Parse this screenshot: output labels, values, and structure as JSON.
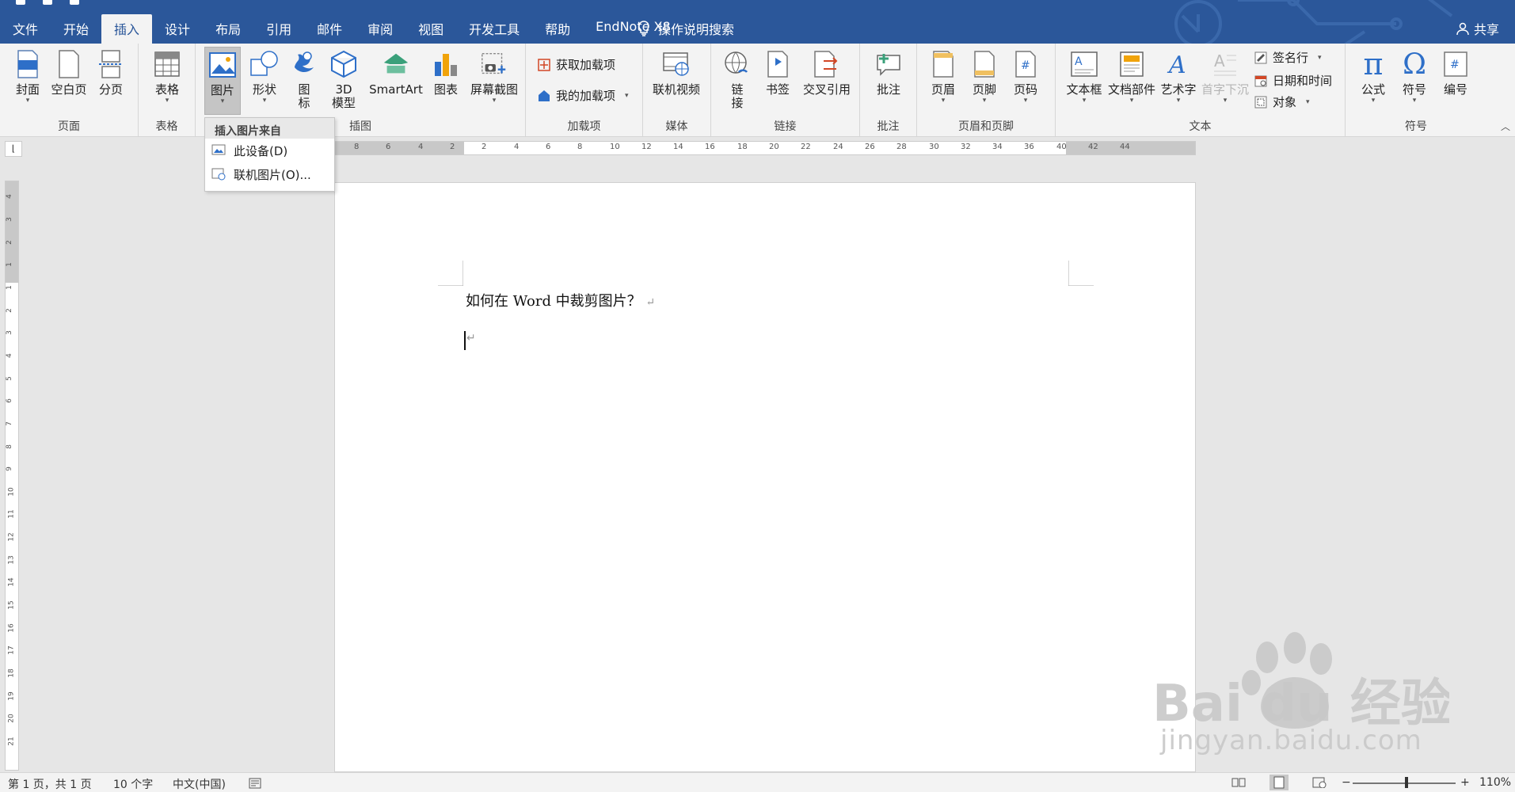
{
  "tabs": [
    "文件",
    "开始",
    "插入",
    "设计",
    "布局",
    "引用",
    "邮件",
    "审阅",
    "视图",
    "开发工具",
    "帮助",
    "EndNote X8"
  ],
  "active_tab": "插入",
  "tell_me": "操作说明搜索",
  "share": "共享",
  "ribbon": {
    "pages": {
      "label": "页面",
      "cover": "封面",
      "blank": "空白页",
      "break": "分页"
    },
    "tables": {
      "label": "表格",
      "table": "表格"
    },
    "illustrations": {
      "label": "插图",
      "pictures": "图片",
      "shapes": "形状",
      "icons_l1": "图",
      "icons_l2": "标",
      "model3d_l1": "3D",
      "model3d_l2": "模型",
      "smartart": "SmartArt",
      "chart": "图表",
      "screenshot": "屏幕截图"
    },
    "addins": {
      "label": "加载项",
      "get": "获取加载项",
      "my": "我的加载项"
    },
    "media": {
      "label": "媒体",
      "video": "联机视频"
    },
    "links": {
      "label": "链接",
      "link_l1": "链",
      "link_l2": "接",
      "bookmark": "书签",
      "crossref": "交叉引用"
    },
    "comments": {
      "label": "批注",
      "comment": "批注"
    },
    "header_footer": {
      "label": "页眉和页脚",
      "header": "页眉",
      "footer": "页脚",
      "page_number": "页码"
    },
    "text": {
      "label": "文本",
      "textbox": "文本框",
      "quickparts": "文档部件",
      "wordart": "艺术字",
      "dropcap": "首字下沉",
      "signature": "签名行",
      "datetime": "日期和时间",
      "object": "对象"
    },
    "symbols": {
      "label": "符号",
      "equation": "公式",
      "symbol": "符号",
      "numbering": "编号"
    }
  },
  "picture_menu": {
    "header": "插入图片来自",
    "items": [
      "此设备(D)",
      "联机图片(O)..."
    ]
  },
  "ruler_numbers_h": [
    "8",
    "6",
    "4",
    "2",
    "2",
    "4",
    "6",
    "8",
    "10",
    "12",
    "14",
    "16",
    "18",
    "20",
    "22",
    "24",
    "26",
    "28",
    "30",
    "32",
    "34",
    "36",
    "40",
    "42",
    "44"
  ],
  "ruler_numbers_v": [
    "4",
    "3",
    "2",
    "1",
    "1",
    "2",
    "3",
    "4",
    "5",
    "6",
    "7",
    "8",
    "9",
    "10",
    "11",
    "12",
    "13",
    "14",
    "15",
    "16",
    "17",
    "18",
    "19",
    "20",
    "21"
  ],
  "document": {
    "title_line": "如何在 Word 中裁剪图片？",
    "para_mark": "↵"
  },
  "status": {
    "page": "第 1 页，共 1 页",
    "words": "10 个字",
    "language": "中文(中国)",
    "zoom_minus": "−",
    "zoom_plus": "+",
    "zoom": "110%"
  },
  "watermark": {
    "brand": "Bai du 经验",
    "url": "jingyan.baidu.com"
  },
  "colors": {
    "title_bar": "#2b579a",
    "ribbon_bg": "#f3f3f3",
    "canvas": "#e6e6e6"
  }
}
